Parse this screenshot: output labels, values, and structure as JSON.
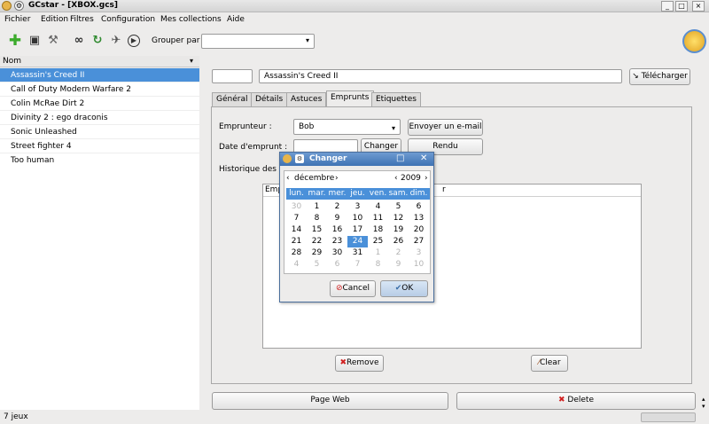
{
  "window": {
    "title": "GCstar - [XBOX.gcs]",
    "controls": [
      "_",
      "□",
      "×"
    ]
  },
  "menu": [
    "Fichier",
    "Edition",
    "Filtres",
    "Configuration",
    "Mes collections",
    "Aide"
  ],
  "toolbar": {
    "group_label": "Grouper par",
    "group_value": ""
  },
  "list": {
    "header": "Nom",
    "items": [
      "Assassin's Creed II",
      "Call of Duty Modern Warfare 2",
      "Colin McRae Dirt 2",
      "Divinity 2 : ego draconis",
      "Sonic Unleashed",
      "Street fighter 4",
      "Too human"
    ],
    "selected": 0
  },
  "detail": {
    "id_value": "",
    "title_value": "Assassin's Creed II",
    "download_label": "Télécharger",
    "tabs": [
      "Général",
      "Détails",
      "Astuces",
      "Emprunts",
      "Etiquettes"
    ],
    "active_tab": 3,
    "borrower_label": "Emprunteur :",
    "borrower_value": "Bob",
    "email_btn": "Envoyer un e-mail",
    "date_label": "Date d'emprunt :",
    "date_value": "",
    "change_btn": "Changer",
    "rendu_btn": "Rendu",
    "history_label": "Historique des e",
    "hist_col1": "Emp",
    "hist_col2": "r",
    "remove_btn": "Remove",
    "clear_btn": "Clear",
    "web_btn": "Page Web",
    "delete_btn": "Delete"
  },
  "status": "7 jeux",
  "dialog": {
    "title": "Changer",
    "month": "décembre",
    "year": "2009",
    "days": [
      "lun.",
      "mar.",
      "mer.",
      "jeu.",
      "ven.",
      "sam.",
      "dim."
    ],
    "weeks": [
      [
        "30",
        "1",
        "2",
        "3",
        "4",
        "5",
        "6"
      ],
      [
        "7",
        "8",
        "9",
        "10",
        "11",
        "12",
        "13"
      ],
      [
        "14",
        "15",
        "16",
        "17",
        "18",
        "19",
        "20"
      ],
      [
        "21",
        "22",
        "23",
        "24",
        "25",
        "26",
        "27"
      ],
      [
        "28",
        "29",
        "30",
        "31",
        "1",
        "2",
        "3"
      ],
      [
        "4",
        "5",
        "6",
        "7",
        "8",
        "9",
        "10"
      ]
    ],
    "selected_day": "24",
    "cancel": "Cancel",
    "ok": "OK"
  }
}
